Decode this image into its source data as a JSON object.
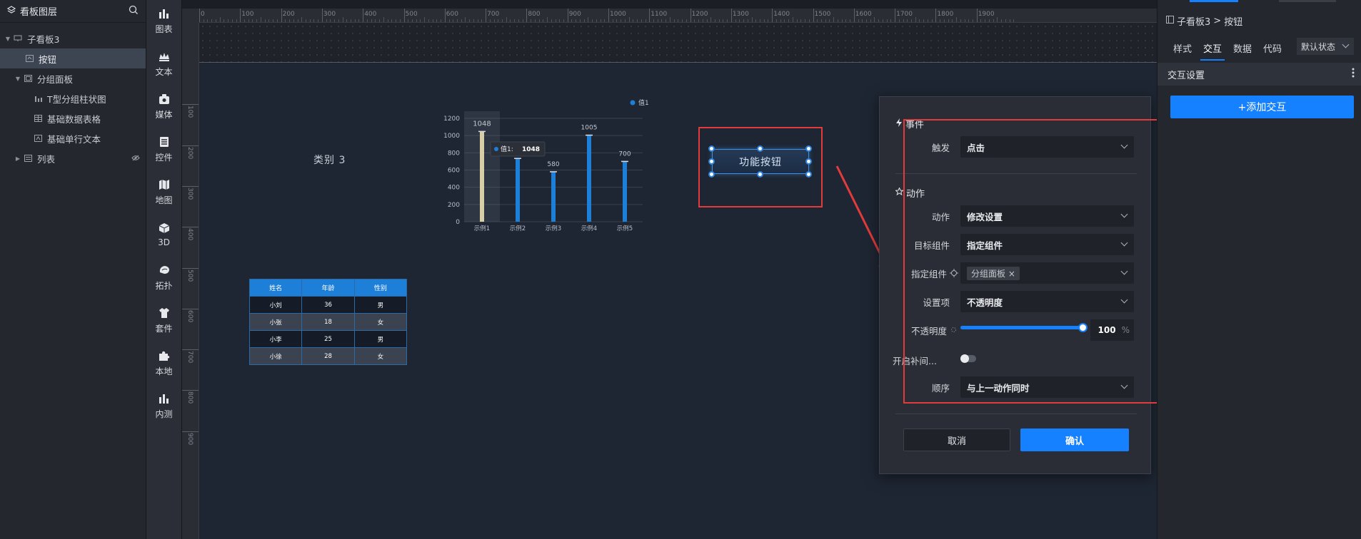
{
  "layers": {
    "title": "看板图层",
    "items": [
      {
        "label": "子看板3",
        "icon": "monitor-icon",
        "caret": "▼"
      },
      {
        "label": "按钮",
        "icon": "button-icon"
      },
      {
        "label": "分组面板",
        "icon": "panel-icon",
        "caret": "▼"
      },
      {
        "label": "T型分组柱状图",
        "icon": "bar-chart-icon"
      },
      {
        "label": "基础数据表格",
        "icon": "table-icon"
      },
      {
        "label": "基础单行文本",
        "icon": "text-icon"
      },
      {
        "label": "列表",
        "icon": "list-icon",
        "caret": "▶"
      }
    ]
  },
  "components": [
    "图表",
    "文本",
    "媒体",
    "控件",
    "地图",
    "3D",
    "拓扑",
    "套件",
    "本地",
    "内测"
  ],
  "ruler": {
    "top": [
      "0",
      "100",
      "200",
      "300",
      "400",
      "500",
      "600",
      "700",
      "800",
      "900",
      "1000",
      "1100",
      "1200",
      "1300",
      "1400",
      "1500",
      "1600",
      "1700",
      "1800",
      "1900"
    ],
    "left": [
      "100",
      "200",
      "300",
      "400",
      "500",
      "600",
      "700",
      "800",
      "900"
    ]
  },
  "canvas": {
    "category_text": "类别 3",
    "button_text": "功能按钮"
  },
  "chart_data": {
    "type": "bar",
    "categories": [
      "示例1",
      "示例2",
      "示例3",
      "示例4",
      "示例5"
    ],
    "series": [
      {
        "name": "值1",
        "values": [
          1048,
          735,
          580,
          1005,
          700
        ]
      }
    ],
    "data_labels": [
      "1048",
      "",
      "580",
      "1005",
      "700"
    ],
    "ylim": [
      0,
      1200
    ],
    "yticks": [
      "0",
      "200",
      "400",
      "600",
      "800",
      "1000",
      "1200"
    ],
    "tooltip": {
      "label": "值1:",
      "value": "1048"
    },
    "colors": {
      "bar": "#1e7fd9",
      "highlight": "#d8cfa6"
    }
  },
  "table": {
    "headers": [
      "姓名",
      "年龄",
      "性别"
    ],
    "rows": [
      [
        "小刘",
        "36",
        "男"
      ],
      [
        "小张",
        "18",
        "女"
      ],
      [
        "小李",
        "25",
        "男"
      ],
      [
        "小徐",
        "28",
        "女"
      ]
    ]
  },
  "dialog": {
    "event_title": "事件",
    "trigger_label": "触发",
    "trigger_value": "点击",
    "action_title": "动作",
    "action_label": "动作",
    "action_value": "修改设置",
    "target_label": "目标组件",
    "target_value": "指定组件",
    "specify_label": "指定组件",
    "specify_tag": "分组面板",
    "setting_label": "设置项",
    "setting_value": "不透明度",
    "opacity_label": "不透明度",
    "opacity_value": "100",
    "opacity_unit": "%",
    "tween_label": "开启补间...",
    "order_label": "顺序",
    "order_value": "与上一动作同时",
    "cancel": "取消",
    "confirm": "确认"
  },
  "props": {
    "breadcrumb_parent": "子看板3",
    "breadcrumb_sep": ">",
    "breadcrumb_current": "按钮",
    "tabs": [
      "样式",
      "交互",
      "数据",
      "代码"
    ],
    "state": "默认状态",
    "section": "交互设置",
    "add_button": "+添加交互"
  },
  "colors": {
    "accent": "#1681ff",
    "highlight_box": "#e23b3b"
  }
}
